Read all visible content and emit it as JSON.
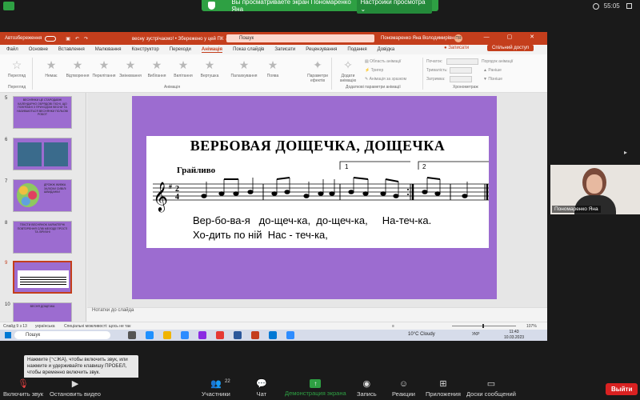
{
  "zoom": {
    "share_banner": "Вы просматриваете экран Пономаренко Яна",
    "view_options": "Настройки просмотра ⌄",
    "clock": "55:05",
    "participant_name": "Пономаренко Яна",
    "tooltip": "Нажмите  {⌥ЖA}, чтобы включить звук, или нажмите и удерживайте клавишу ПРОБЕЛ, чтобы временно включить звук.",
    "toolbar": {
      "mute": "Включить звук",
      "video": "Остановить видео",
      "participants": "Участники",
      "participants_count": "22",
      "chat": "Чат",
      "share": "Демонстрация экрана",
      "record": "Запись",
      "reactions": "Реакции",
      "apps": "Приложения",
      "whiteboards": "Доски сообщений",
      "leave": "Выйти"
    }
  },
  "ppt": {
    "autosave": "Автозбереження",
    "doc_title": "весну зустрічаємо! • Збережено у цей ПК ⌄",
    "search_placeholder": "Пошук",
    "user": "Пономаренко Яна Володимирівна",
    "user_initials": "ПЯ",
    "tabs": [
      "Файл",
      "Основне",
      "Вставлення",
      "Малювання",
      "Конструктор",
      "Переходи",
      "Анімація",
      "Показ слайдів",
      "Записати",
      "Рецензування",
      "Подання",
      "Довідка"
    ],
    "active_tab": "Анімація",
    "record_btn": "Записати",
    "share_btn": "Спільний доступ",
    "ribbon": {
      "preview": "Перегляд",
      "preview_group": "Перегляд",
      "animations": [
        "Немає",
        "Відтворення",
        "Перелітання",
        "Змінювання",
        "Вибігання",
        "Вилітання",
        "Вертушка",
        "Палахкування",
        "Поява"
      ],
      "animation_group": "Анімація",
      "effect_params": "Параметри ефектів",
      "add_animation": "Додати анімацію",
      "anim_pane": "Область анімації",
      "trigger": "Тригер",
      "painter": "Анімація за зразком",
      "advanced_group": "Додаткові параметри анімації",
      "start": "Початок:",
      "duration": "Тривалість:",
      "delay": "Затримка:",
      "reorder": "Порядок анімації",
      "earlier": "Раніше",
      "later": "Пізніше",
      "timing_group": "Хронометраж"
    },
    "thumbnails": [
      {
        "num": "5",
        "text": "ВЕСНЯНКИ ЦЕ СТАРОДАВНІ КАЛЕНДАРНО ОБРЯДОВІ ПІСНІ, ЩО ПОВ'ЯЗАНІ З ПРИХОДОМ ВЕСНИ ТА НАЗИВАЮТЬСЯ ВЕСНЯНКИ ПОЛЬОВІ РОБОТ"
      },
      {
        "num": "6",
        "text": ""
      },
      {
        "num": "7",
        "text": "ДРОЖЖ ЖИВКА ЗАЛІСКИ СИВІЛІ ШВИДАНКИ"
      },
      {
        "num": "8",
        "text": "ТЕКСТИ ВЕСНЯНОК ХАРАКТЕРНІ ПОВТОРЕННЯ СЛІВ МЕЛОДІЇ ПРОСТІ ТА ЛІРИЧНІ"
      },
      {
        "num": "9",
        "text": ""
      },
      {
        "num": "10",
        "text": "ВЕСНЯ ДОЩЕЧКА"
      }
    ],
    "slide": {
      "title": "ВЕРБОВАЯ ДОЩЕЧКА, ДОЩЕЧКА",
      "tempo": "Грайливо",
      "lyric1": "Вер-бо-ва-я   до-щеч-ка,  до-щеч-ка,     На-теч-ка.",
      "lyric2": "Хо-дить по ній  Нас - теч-ка,",
      "volta1": "1",
      "volta2": "2"
    },
    "notes": "Нотатки до слайда",
    "status": {
      "slide": "Слайд 9 з 13",
      "lang": "українська",
      "accessibility": "Спеціальні можливості: щось не так",
      "zoom": "107%"
    }
  },
  "taskbar": {
    "search": "Пошук",
    "weather": "10°C  Cloudy",
    "lang": "УКР",
    "time": "11:43",
    "date": "10.03.2023"
  }
}
